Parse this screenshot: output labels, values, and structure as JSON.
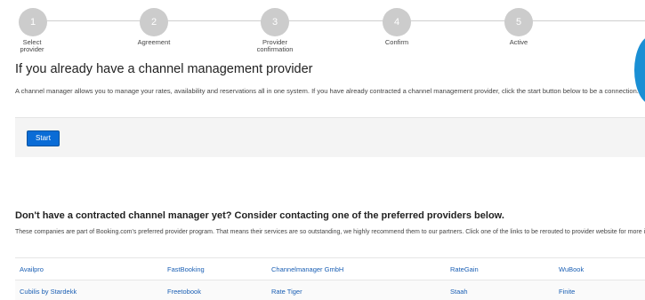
{
  "stepper": {
    "steps": [
      {
        "number": "1",
        "label": "Select\nprovider"
      },
      {
        "number": "2",
        "label": "Agreement"
      },
      {
        "number": "3",
        "label": "Provider\nconfirmation"
      },
      {
        "number": "4",
        "label": "Confirm"
      },
      {
        "number": "5",
        "label": "Active"
      }
    ]
  },
  "main": {
    "title": "If you already have a channel management provider",
    "intro": "A channel manager allows you to manage your rates, availability and reservations all in one system. If you have already contracted a channel management provider, click the start button below to be a connection.",
    "start_label": "Start"
  },
  "providers": {
    "title": "Don't have a contracted channel manager yet? Consider contacting one of the preferred providers below.",
    "description": "These companies are part of Booking.com's preferred provider program. That means their services are so outstanding, we highly recommend them to our partners. Click one of the links to be rerouted to provider website for more info.",
    "rows": [
      [
        "Availpro",
        "FastBooking",
        "Channelmanager GmbH",
        "RateGain",
        "WuBook"
      ],
      [
        "Cubilis by Stardekk",
        "Freetobook",
        "Rate Tiger",
        "Staah",
        "Finite"
      ]
    ]
  },
  "colors": {
    "accent": "#0a6cd6",
    "link": "#1a5fb4",
    "step_inactive": "#cccccc"
  }
}
